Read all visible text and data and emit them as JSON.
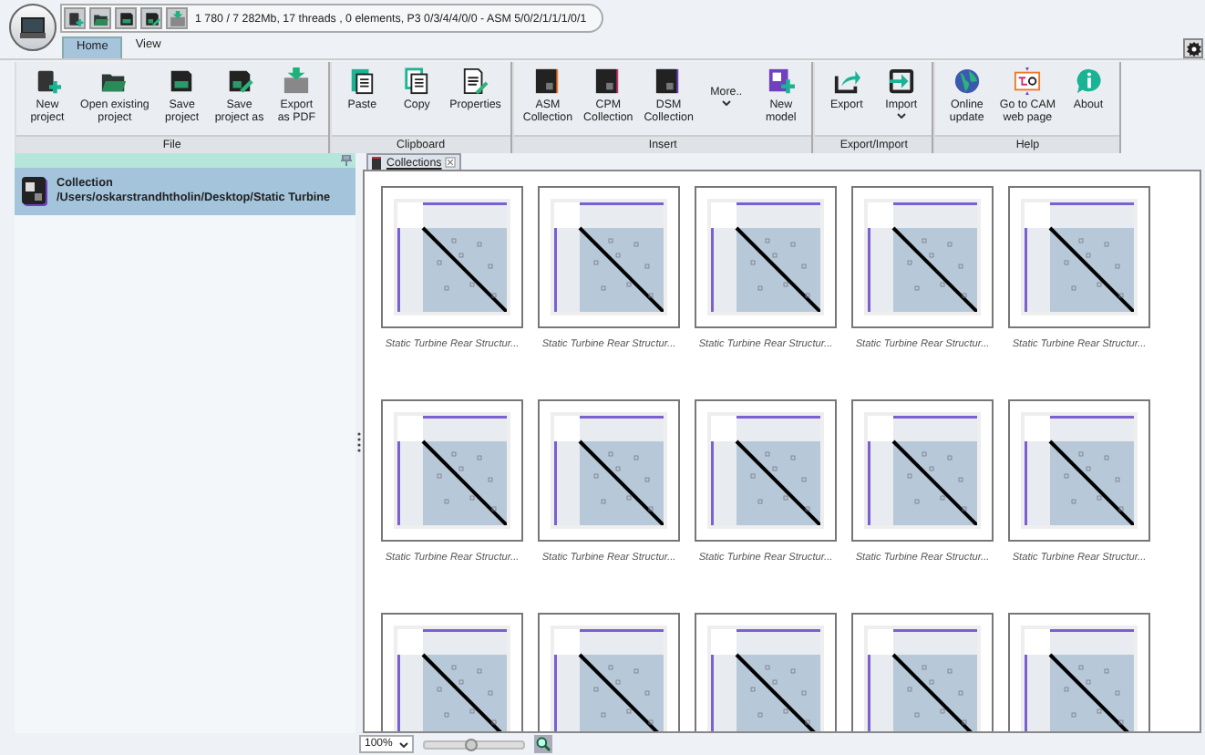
{
  "quick_access": {
    "status": "1 780 / 7 282Mb, 17 threads , 0 elements, P3 0/3/4/4/0/0 - ASM 5/0/2/1/1/1/0/1"
  },
  "tabs": [
    {
      "label": "Home",
      "selected": true
    },
    {
      "label": "View",
      "selected": false
    }
  ],
  "ribbon": [
    {
      "label": "File",
      "buttons": [
        {
          "label": "New\nproject"
        },
        {
          "label": "Open existing\nproject"
        },
        {
          "label": "Save\nproject"
        },
        {
          "label": "Save\nproject as"
        },
        {
          "label": "Export\nas PDF"
        }
      ]
    },
    {
      "label": "Clipboard",
      "buttons": [
        {
          "label": "Paste"
        },
        {
          "label": "Copy"
        },
        {
          "label": "Properties"
        }
      ]
    },
    {
      "label": "Insert",
      "buttons": [
        {
          "label": "ASM\nCollection"
        },
        {
          "label": "CPM\nCollection"
        },
        {
          "label": "DSM\nCollection"
        },
        {
          "label": "More..",
          "dropdown": true
        },
        {
          "label": "New\nmodel"
        }
      ]
    },
    {
      "label": "Export/Import",
      "buttons": [
        {
          "label": "Export"
        },
        {
          "label": "Import",
          "dropdown": true
        }
      ]
    },
    {
      "label": "Help",
      "buttons": [
        {
          "label": "Online\nupdate"
        },
        {
          "label": "Go to CAM\nweb page"
        },
        {
          "label": "About"
        }
      ]
    }
  ],
  "sidebar": {
    "items": [
      {
        "title": "Collection",
        "path": "/Users/oskarstrandhtholin/Desktop/Static Turbine",
        "selected": true
      }
    ]
  },
  "document_tab": {
    "label": "Collections"
  },
  "thumbnails": [
    {
      "kind": "thumbnail",
      "caption": "Static Turbine Rear Structur..."
    },
    {
      "kind": "thumbnail",
      "caption": "Static Turbine Rear Structur..."
    },
    {
      "kind": "thumbnail",
      "caption": "Static Turbine Rear Structur..."
    },
    {
      "kind": "thumbnail",
      "caption": "Static Turbine Rear Structur..."
    },
    {
      "kind": "thumbnail",
      "caption": "Static Turbine Rear Structur..."
    },
    {
      "kind": "thumbnail",
      "caption": "Static Turbine Rear Structur..."
    },
    {
      "kind": "thumbnail",
      "caption": "Static Turbine Rear Structur..."
    },
    {
      "kind": "thumbnail",
      "caption": "Static Turbine Rear Structur..."
    },
    {
      "kind": "thumbnail",
      "caption": "Static Turbine Rear Structur..."
    },
    {
      "kind": "thumbnail",
      "caption": "Static Turbine Rear Structur..."
    },
    {
      "kind": "thumbnail"
    },
    {
      "kind": "thumbnail"
    },
    {
      "kind": "thumbnail"
    },
    {
      "kind": "thumbnail"
    },
    {
      "kind": "thumbnail"
    }
  ],
  "status_bar": {
    "zoom": "100%",
    "zoom_slider": {
      "level": 0.45
    }
  }
}
